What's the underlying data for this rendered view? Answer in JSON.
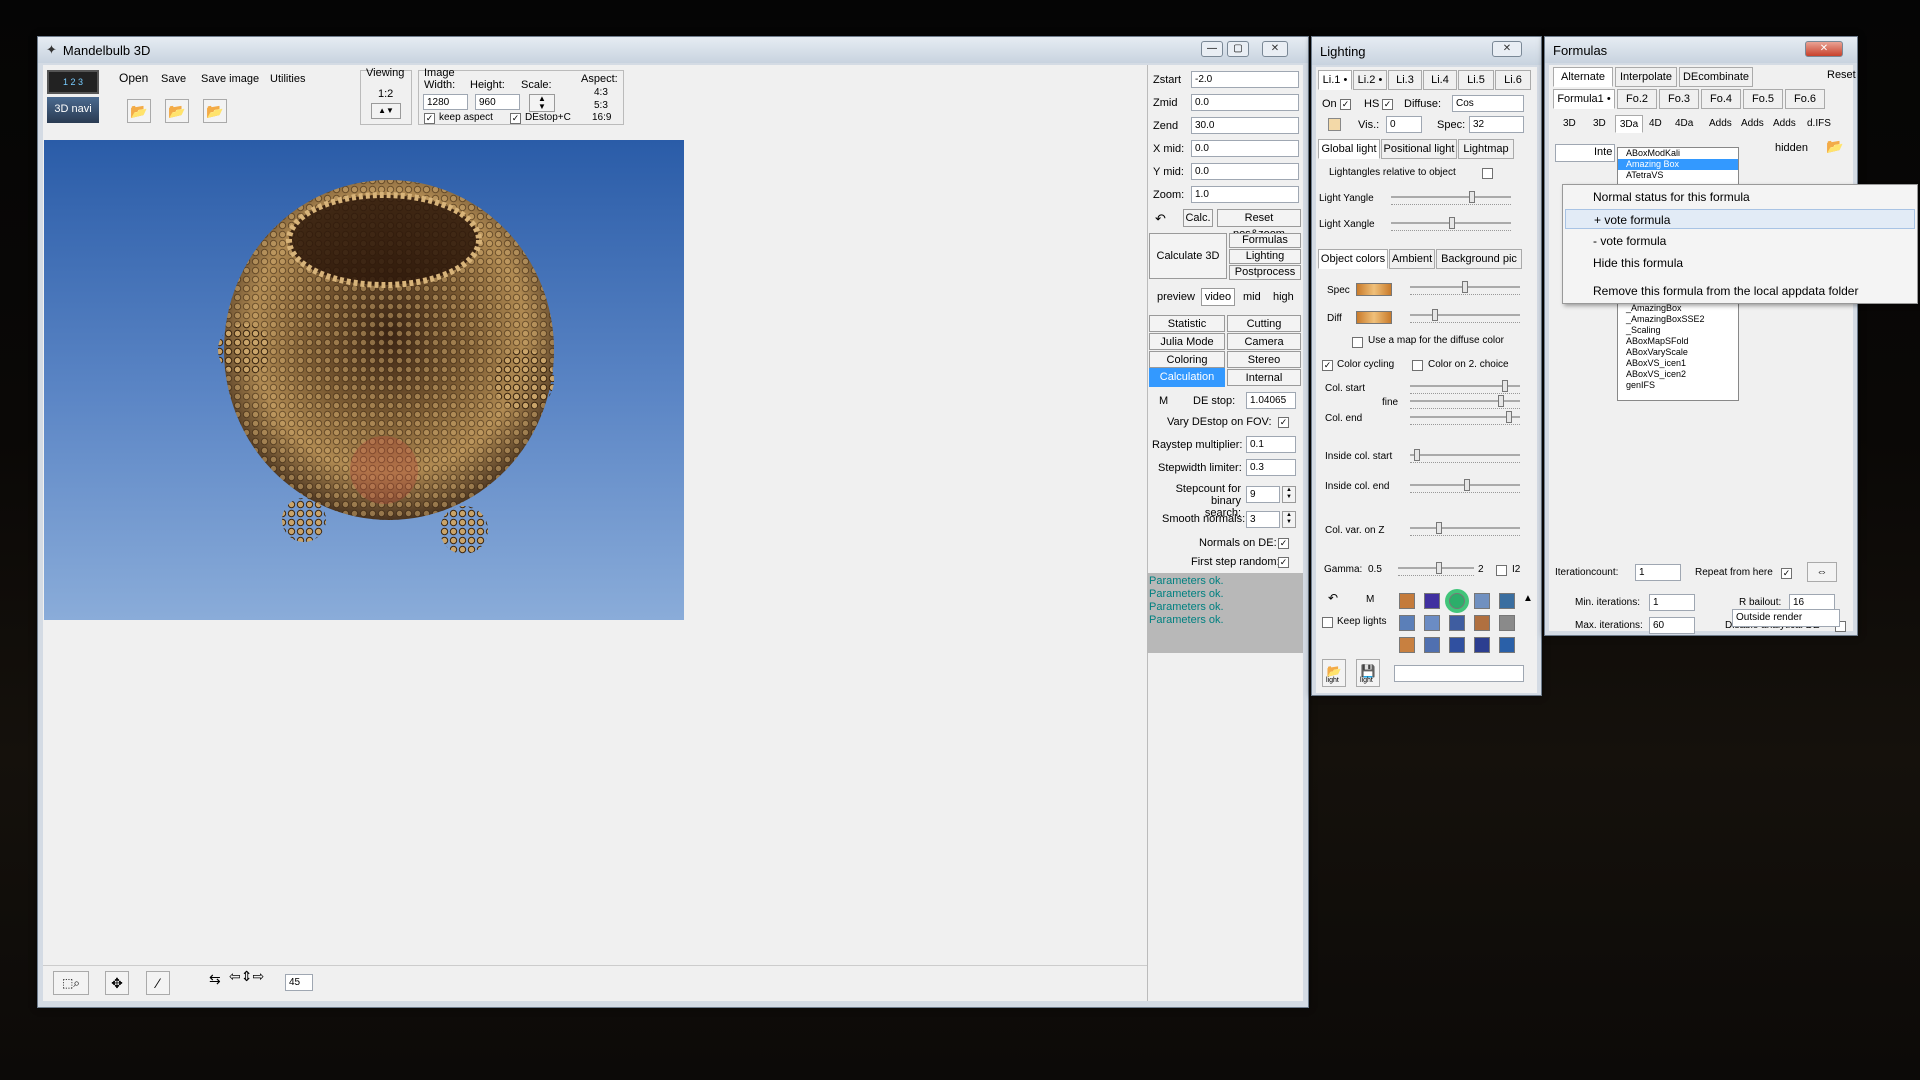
{
  "main": {
    "title": "Mandelbulb 3D",
    "toolbar": {
      "open": "Open",
      "save": "Save",
      "save_image": "Save image",
      "utilities": "Utilities",
      "navi": "3D navi",
      "viewing": "Viewing",
      "ratio": "1:2",
      "image": "Image",
      "width_label": "Width:",
      "height_label": "Height:",
      "width": "1280",
      "height": "960",
      "scale": "Scale:",
      "aspect": "Aspect:",
      "aspects": [
        "4:3",
        "5:3",
        "16:9"
      ],
      "keep_aspect": "keep aspect",
      "destop": "DEstop+C"
    },
    "params": [
      {
        "label": "Zstart",
        "value": "-2.0"
      },
      {
        "label": "Zmid",
        "value": "0.0"
      },
      {
        "label": "Zend",
        "value": "30.0"
      },
      {
        "label": "X mid:",
        "value": "0.0"
      },
      {
        "label": "Y mid:",
        "value": "0.0"
      },
      {
        "label": "Zoom:",
        "value": "1.0"
      }
    ],
    "calc": "Calc.",
    "reset": "Reset pos&zoom",
    "calculate3d": "Calculate 3D",
    "formulas": "Formulas",
    "lighting": "Lighting",
    "postprocess": "Postprocess",
    "quality": [
      "preview",
      "video",
      "mid",
      "high"
    ],
    "tabs": [
      "Statistic",
      "Cutting",
      "Julia Mode",
      "Camera",
      "Coloring",
      "Stereo",
      "Calculation",
      "Internal"
    ],
    "m": "M",
    "destop_label": "DE stop:",
    "destop_value": "1.04065",
    "vary_destop": "Vary DEstop on FOV:",
    "raystep": "Raystep multiplier:",
    "raystep_value": "0.1",
    "stepwidth": "Stepwidth limiter:",
    "stepwidth_value": "0.3",
    "stepcount": "Stepcount for binary search:",
    "stepcount_value": "9",
    "smooth": "Smooth  normals:",
    "smooth_value": "3",
    "normals_de": "Normals on DE:",
    "first_step": "First step random:",
    "status": [
      "Parameters ok.",
      "Parameters ok.",
      "Parameters ok.",
      "Parameters ok."
    ],
    "bottom_value": "45"
  },
  "lighting": {
    "title": "Lighting",
    "lights": [
      "Li.1 •",
      "Li.2 •",
      "Li.3",
      "Li.4",
      "Li.5",
      "Li.6"
    ],
    "on": "On",
    "hs": "HS",
    "diffuse": "Diffuse:",
    "diffuse_value": "Cos",
    "vis": "Vis.:",
    "vis_value": "0",
    "spec": "Spec:",
    "spec_value": "32",
    "light_tabs": [
      "Global light",
      "Positional light",
      "Lightmap"
    ],
    "lightangles": "Lightangles relative to object",
    "yangle": "Light Yangle",
    "xangle": "Light Xangle",
    "color_tabs": [
      "Object colors",
      "Ambient",
      "Background pic"
    ],
    "spec_label": "Spec",
    "diff_label": "Diff",
    "use_map": "Use a map for the diffuse color",
    "color_cycling": "Color cycling",
    "color_on2": "Color on 2. choice",
    "col_start": "Col. start",
    "fine": "fine",
    "col_end": "Col. end",
    "inside_start": "Inside col. start",
    "inside_end": "Inside col. end",
    "col_var": "Col. var. on Z",
    "gamma": "Gamma:",
    "gamma_value": "0.5",
    "gamma_2": "2",
    "i2": "I2",
    "m": "M",
    "keep_lights": "Keep lights",
    "light_label": "light",
    "spec_color": "#e1a24e",
    "diff_color": "#e2a24c"
  },
  "formulas": {
    "title": "Formulas",
    "top_tabs": [
      "Alternate",
      "Interpolate",
      "DEcombinate"
    ],
    "reset": "Reset",
    "formula_tabs": [
      "Formula1 •",
      "Fo.2",
      "Fo.3",
      "Fo.4",
      "Fo.5",
      "Fo.6"
    ],
    "dim_tabs": [
      "3D",
      "3D",
      "3Da",
      "4D",
      "4Da",
      "Adds",
      "Adds",
      "Adds",
      "d.IFS"
    ],
    "inte": "Inte",
    "hidden": "hidden",
    "dropdown_items": [
      "ABoxModKali",
      "Amazing Box",
      "ATetraVS"
    ],
    "list_items": [
      "_AmazingBox",
      "_AmazingBoxSSE2",
      "_Scaling",
      "ABoxMapSFold",
      "ABoxVaryScale",
      "ABoxVS_icen1",
      "ABoxVS_icen2",
      "genIFS"
    ],
    "iterationcount": "Iterationcount:",
    "iteration_value": "1",
    "repeat": "Repeat from here",
    "min_iter": "Min. iterations:",
    "min_value": "1",
    "max_iter": "Max. iterations:",
    "max_value": "60",
    "rbailout": "R bailout:",
    "rbailout_value": "16",
    "disable_de": "Disable analytical DE",
    "outside": "Outside render"
  },
  "context_menu": [
    "Normal status for this formula",
    "+ vote formula",
    "- vote formula",
    "Hide this formula",
    "Remove this formula from the local appdata folder"
  ]
}
